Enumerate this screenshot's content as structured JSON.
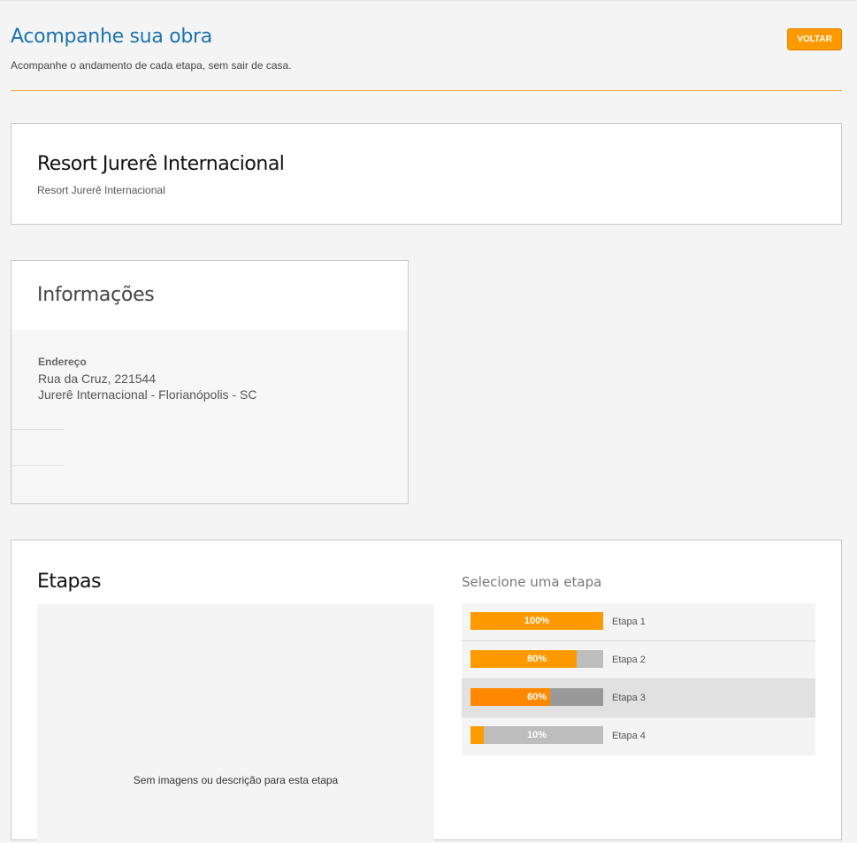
{
  "header": {
    "title": "Acompanhe sua obra",
    "subtitle": "Acompanhe o andamento de cada etapa, sem sair de casa.",
    "back_label": "VOLTAR"
  },
  "project": {
    "name": "Resort Jurerê Internacional",
    "subtitle": "Resort Jurerê Internacional"
  },
  "info": {
    "title": "Informações",
    "address_label": "Endereço",
    "address_line1": "Rua da Cruz, 221544",
    "address_line2": "Jurerê Internacional - Florianópolis - SC"
  },
  "stages": {
    "title": "Etapas",
    "empty_message": "Sem imagens ou descrição para esta etapa",
    "select_heading": "Selecione uma etapa",
    "selected_index": 2,
    "items": [
      {
        "label": "Etapa 1",
        "percent": 100,
        "percent_text": "100%"
      },
      {
        "label": "Etapa 2",
        "percent": 80,
        "percent_text": "80%"
      },
      {
        "label": "Etapa 3",
        "percent": 60,
        "percent_text": "60%"
      },
      {
        "label": "Etapa 4",
        "percent": 10,
        "percent_text": "10%"
      }
    ]
  },
  "colors": {
    "accent": "#ff9900",
    "title_blue": "#1d73b0"
  }
}
